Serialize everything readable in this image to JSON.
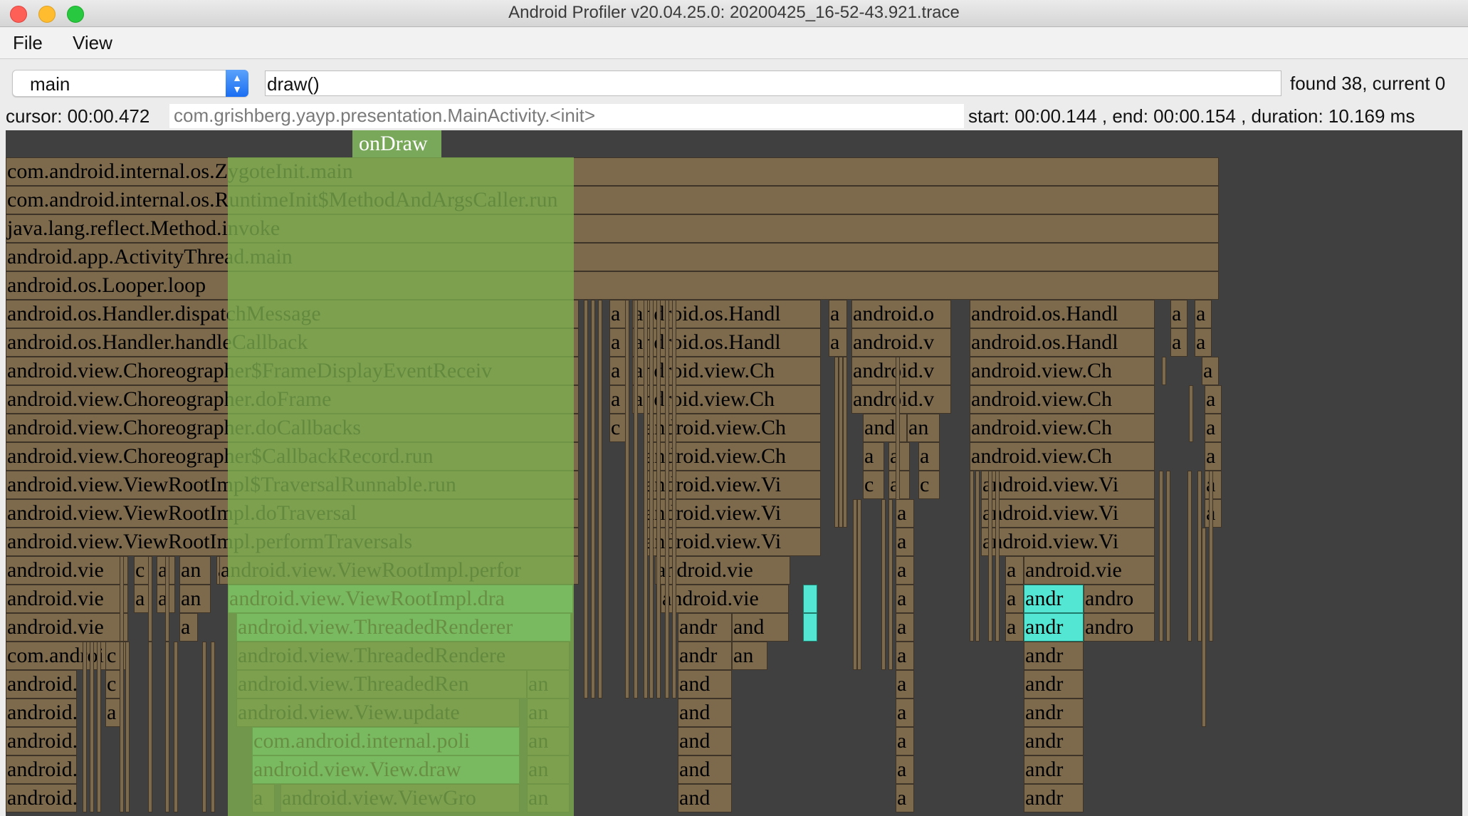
{
  "window": {
    "title": "Android Profiler v20.04.25.0: 20200425_16-52-43.921.trace"
  },
  "menu": {
    "file": "File",
    "view": "View"
  },
  "toolbar": {
    "thread": "main",
    "search": "draw()",
    "found": "found 38, current 0"
  },
  "info": {
    "cursor": "cursor: 00:00.472",
    "selected": "com.grishberg.yayp.presentation.MainActivity.<init>",
    "range": "start: 00:00.144 , end: 00:00.154 , duration: 10.169 ms"
  },
  "flame": {
    "marker": "onDraw",
    "stack": [
      "com.android.internal.os.ZygoteInit.main",
      "com.android.internal.os.RuntimeInit$MethodAndArgsCaller.run",
      "java.lang.reflect.Method.invoke",
      "android.app.ActivityThread.main",
      "android.os.Looper.loop",
      "android.os.Handler.dispatchMessage",
      "android.os.Handler.handleCallback",
      "android.view.Choreographer$FrameDisplayEventReceiv",
      "android.view.Choreographer.doFrame",
      "android.view.Choreographer.doCallbacks",
      "android.view.Choreographer$CallbackRecord.run",
      "android.view.ViewRootImpl$TraversalRunnable.run",
      "android.view.ViewRootImpl.doTraversal",
      "android.view.ViewRootImpl.performTraversals"
    ],
    "left_deep": [
      "android.vie",
      "android.vie",
      "android.vie",
      "com.androi",
      "android.",
      "android.",
      "android.",
      "android.",
      "android."
    ],
    "green": [
      "android.view.ViewRootImpl.perfor",
      "android.view.ViewRootImpl.dra",
      "android.view.ThreadedRenderer",
      "android.view.ThreadedRendere",
      "android.view.ThreadedRen",
      "android.view.View.update",
      "com.android.internal.poli",
      "android.view.View.draw",
      "android.view.ViewGro"
    ],
    "mid_a": [
      "android.os.Handl",
      "android.os.Handl",
      "android.view.Ch",
      "android.view.Ch",
      "android.view.Ch",
      "android.view.Ch",
      "android.view.Vi",
      "android.view.Vi",
      "android.view.Vi",
      "android.vie",
      "android.vie"
    ],
    "mid_b": [
      "android.o",
      "android.v",
      "android.v",
      "android.v"
    ],
    "right": [
      "android.os.Handl",
      "android.os.Handl",
      "android.view.Ch",
      "android.view.Ch",
      "android.view.Ch",
      "android.view.Ch",
      "android.view.Vi",
      "android.view.Vi",
      "android.view.Vi",
      "android.vie"
    ],
    "andr": "andr",
    "andro": "andro",
    "and": "and",
    "an": "an",
    "a": "a",
    "c": "c"
  }
}
